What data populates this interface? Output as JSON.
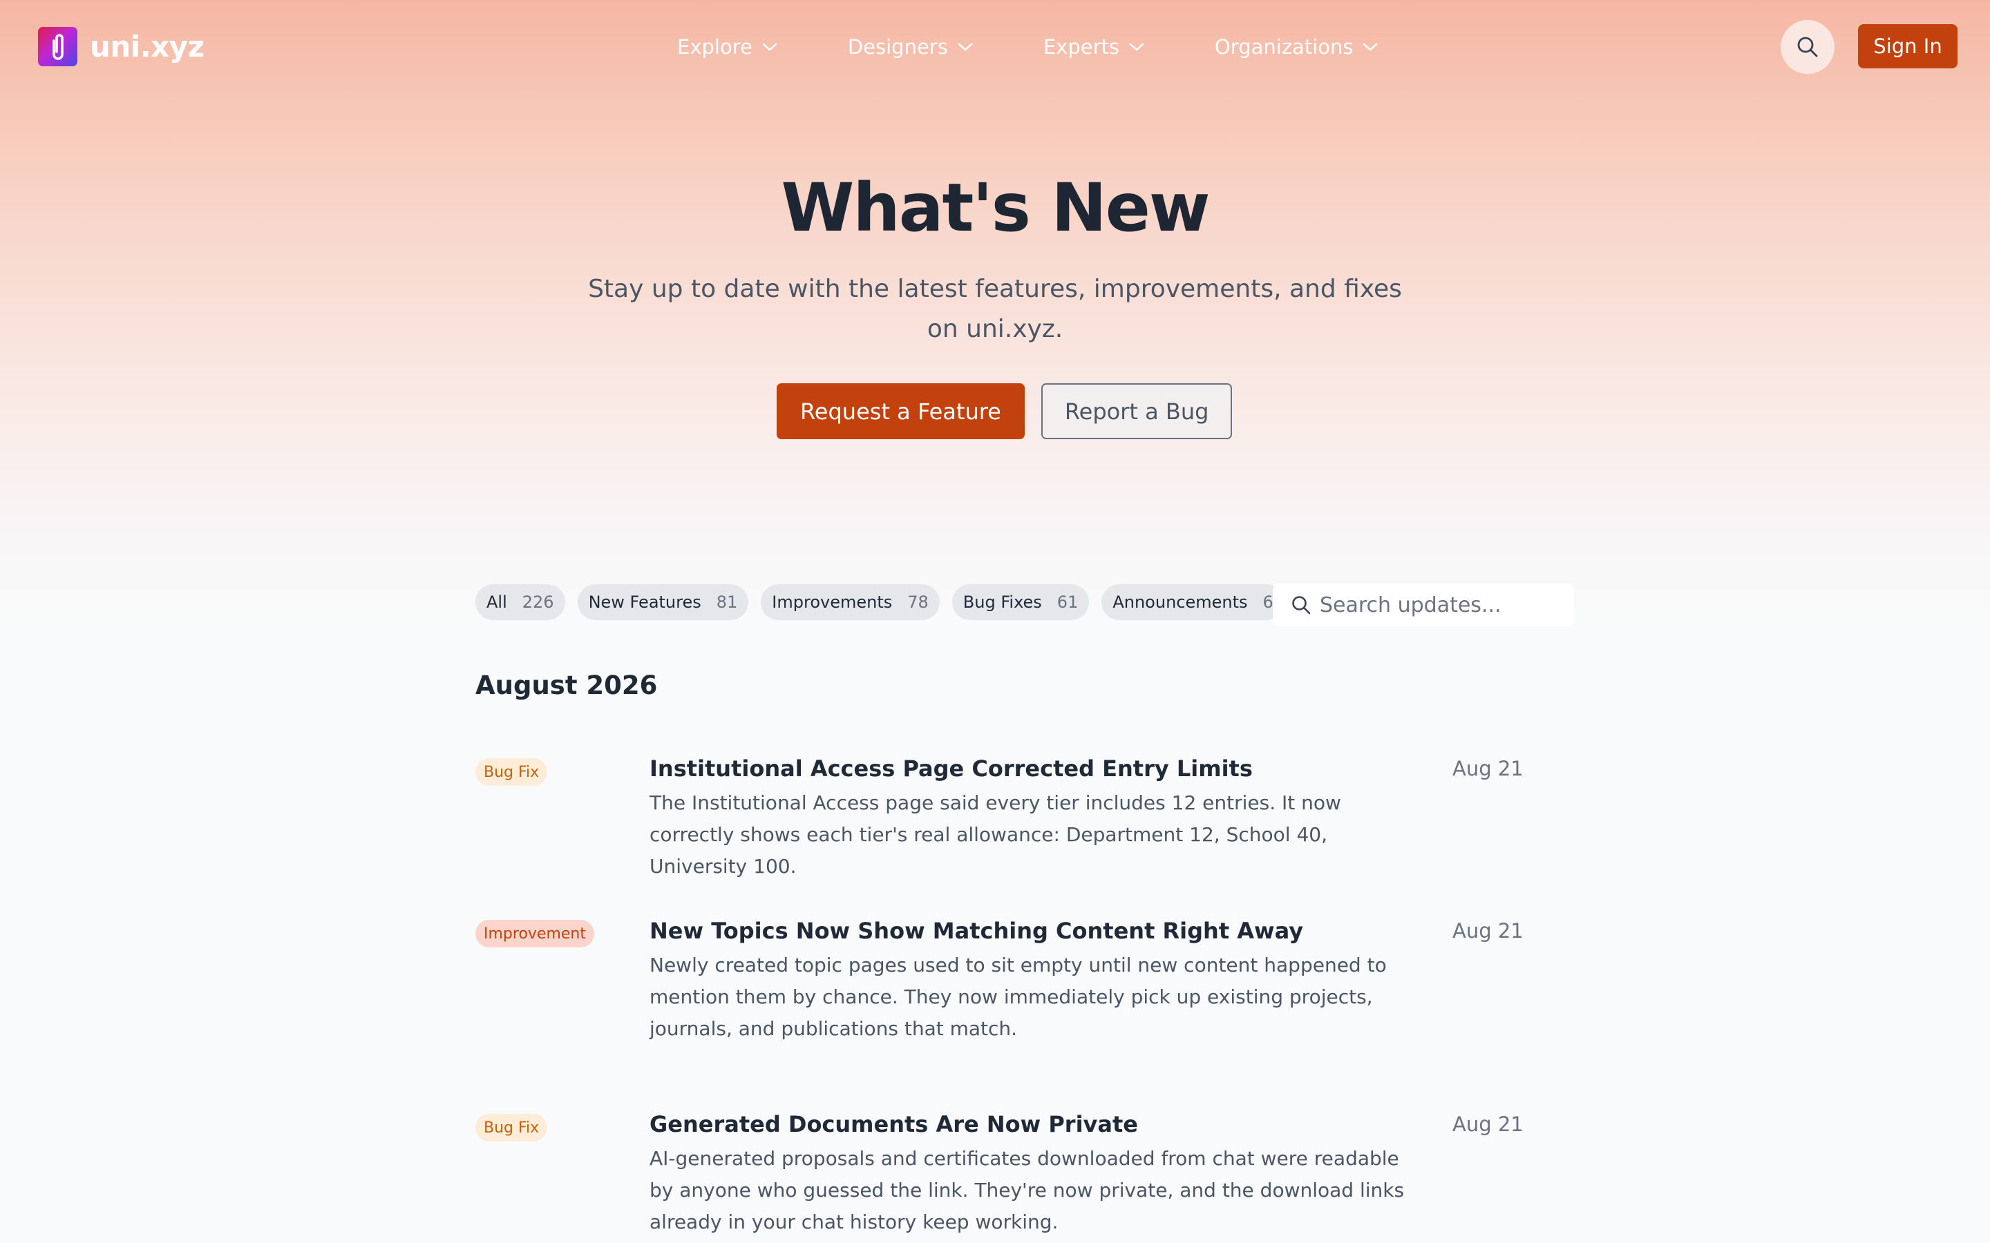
{
  "brand": {
    "name": "uni.xyz",
    "logo_icon": "paperclip-icon",
    "accent_color": "#c2410c"
  },
  "nav": {
    "items": [
      {
        "label": "Explore"
      },
      {
        "label": "Designers"
      },
      {
        "label": "Experts"
      },
      {
        "label": "Organizations"
      }
    ],
    "search_icon": "search-icon",
    "signin_label": "Sign In"
  },
  "hero": {
    "title": "What's New",
    "subtitle": "Stay up to date with the latest features, improvements, and fixes on uni.xyz.",
    "primary_button": "Request a Feature",
    "secondary_button": "Report a Bug"
  },
  "filters": {
    "pills": [
      {
        "label": "All",
        "count": "226"
      },
      {
        "label": "New Features",
        "count": "81"
      },
      {
        "label": "Improvements",
        "count": "78"
      },
      {
        "label": "Bug Fixes",
        "count": "61"
      },
      {
        "label": "Announcements",
        "count": "6"
      }
    ],
    "search_placeholder": "Search updates..."
  },
  "updates": {
    "month": "August 2026",
    "entries": [
      {
        "badge": "Bug Fix",
        "title": "Institutional Access Page Corrected Entry Limits",
        "description": "The Institutional Access page said every tier includes 12 entries. It now correctly shows each tier's real allowance: Department 12, School 40, University 100.",
        "date": "Aug 21"
      },
      {
        "badge": "Improvement",
        "title": "New Topics Now Show Matching Content Right Away",
        "description": "Newly created topic pages used to sit empty until new content happened to mention them by chance. They now immediately pick up existing projects, journals, and publications that match.",
        "date": "Aug 21"
      },
      {
        "badge": "Bug Fix",
        "title": "Generated Documents Are Now Private",
        "description": "AI-generated proposals and certificates downloaded from chat were readable by anyone who guessed the link. They're now private, and the download links already in your chat history keep working.",
        "date": "Aug 21"
      }
    ]
  }
}
